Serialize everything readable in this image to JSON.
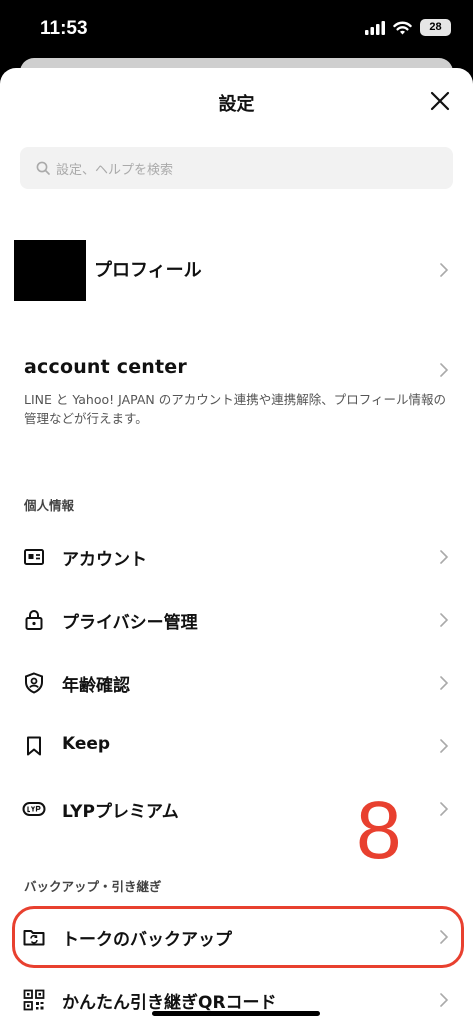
{
  "status_bar": {
    "time": "11:53",
    "battery": "28"
  },
  "header": {
    "title": "設定"
  },
  "search": {
    "placeholder": "設定、ヘルプを検索"
  },
  "profile": {
    "label": "プロフィール"
  },
  "account_center": {
    "title": "account center",
    "description": "LINE と Yahoo! JAPAN のアカウント連携や連携解除、プロフィール情報の管理などが行えます。"
  },
  "personal_section": {
    "heading": "個人情報",
    "items": [
      {
        "label": "アカウント",
        "icon": "id-card-icon"
      },
      {
        "label": "プライバシー管理",
        "icon": "lock-icon"
      },
      {
        "label": "年齢確認",
        "icon": "shield-person-icon"
      },
      {
        "label": "Keep",
        "icon": "bookmark-icon"
      },
      {
        "label": "LYPプレミアム",
        "icon": "lyp-badge-icon"
      }
    ]
  },
  "backup_section": {
    "heading": "バックアップ・引き継ぎ",
    "items": [
      {
        "label": "トークのバックアップ",
        "icon": "folder-sync-icon"
      },
      {
        "label": "かんたん引き継ぎQRコード",
        "icon": "qr-code-icon"
      }
    ]
  },
  "annotation": {
    "number": "8",
    "color": "#e8402f"
  }
}
